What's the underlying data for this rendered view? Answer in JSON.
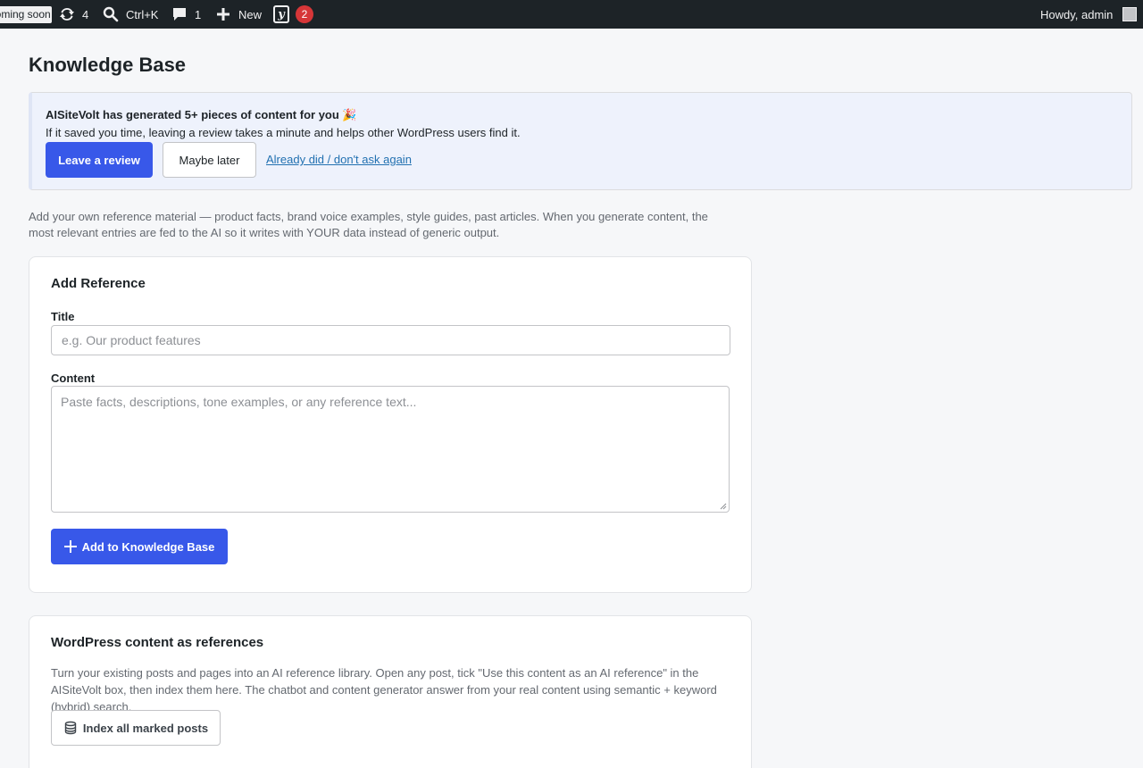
{
  "adminbar": {
    "coming_soon": "Coming soon",
    "updates_count": "4",
    "search_shortcut": "Ctrl+K",
    "comments_count": "1",
    "new_label": "New",
    "yoast_badge": "2",
    "howdy": "Howdy, admin"
  },
  "page": {
    "title": "Knowledge Base"
  },
  "notice": {
    "heading": "AISiteVolt has generated 5+ pieces of content for you 🎉",
    "text": "If it saved you time, leaving a review takes a minute and helps other WordPress users find it.",
    "review_button": "Leave a review",
    "later_button": "Maybe later",
    "dismiss_link": "Already did / don't ask again"
  },
  "intro": "Add your own reference material — product facts, brand voice examples, style guides, past articles. When you generate content, the most relevant entries are fed to the AI so it writes with YOUR data instead of generic output.",
  "add_reference": {
    "title": "Add Reference",
    "title_label": "Title",
    "title_placeholder": "e.g. Our product features",
    "content_label": "Content",
    "content_placeholder": "Paste facts, descriptions, tone examples, or any reference text...",
    "add_button": "Add to Knowledge Base"
  },
  "wp_content": {
    "title": "WordPress content as references",
    "description": "Turn your existing posts and pages into an AI reference library. Open any post, tick \"Use this content as an AI reference\" in the AISiteVolt box, then index them here. The chatbot and content generator answer from your real content using semantic + keyword (hybrid) search.",
    "index_button": "Index all marked posts"
  },
  "colors": {
    "adminbar_bg": "#1d2327",
    "primary": "#3858e9",
    "notice_bg": "#eef2fc",
    "badge_red": "#d63638",
    "link": "#2271b1"
  }
}
